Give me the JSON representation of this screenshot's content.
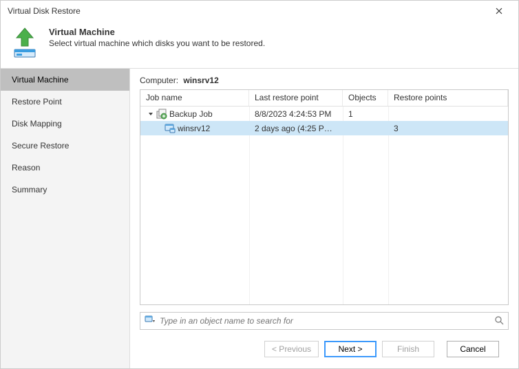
{
  "window": {
    "title": "Virtual Disk Restore"
  },
  "header": {
    "title": "Virtual Machine",
    "subtitle": "Select virtual machine which disks you want to be restored."
  },
  "sidebar": {
    "items": [
      {
        "label": "Virtual Machine",
        "active": true
      },
      {
        "label": "Restore Point",
        "active": false
      },
      {
        "label": "Disk Mapping",
        "active": false
      },
      {
        "label": "Secure Restore",
        "active": false
      },
      {
        "label": "Reason",
        "active": false
      },
      {
        "label": "Summary",
        "active": false
      }
    ]
  },
  "main": {
    "computer_label": "Computer:",
    "computer_value": "winsrv12",
    "columns": {
      "job": "Job name",
      "last": "Last restore point",
      "objects": "Objects",
      "rp": "Restore points"
    },
    "rows": [
      {
        "type": "job",
        "name": "Backup Job",
        "last": "8/8/2023 4:24:53 PM",
        "objects": "1",
        "rp": "",
        "selected": false
      },
      {
        "type": "vm",
        "name": "winsrv12",
        "last": "2 days ago (4:25 PM ...",
        "objects": "",
        "rp": "3",
        "selected": true
      }
    ],
    "search": {
      "placeholder": "Type in an object name to search for"
    }
  },
  "footer": {
    "previous": "< Previous",
    "next": "Next >",
    "finish": "Finish",
    "cancel": "Cancel"
  }
}
